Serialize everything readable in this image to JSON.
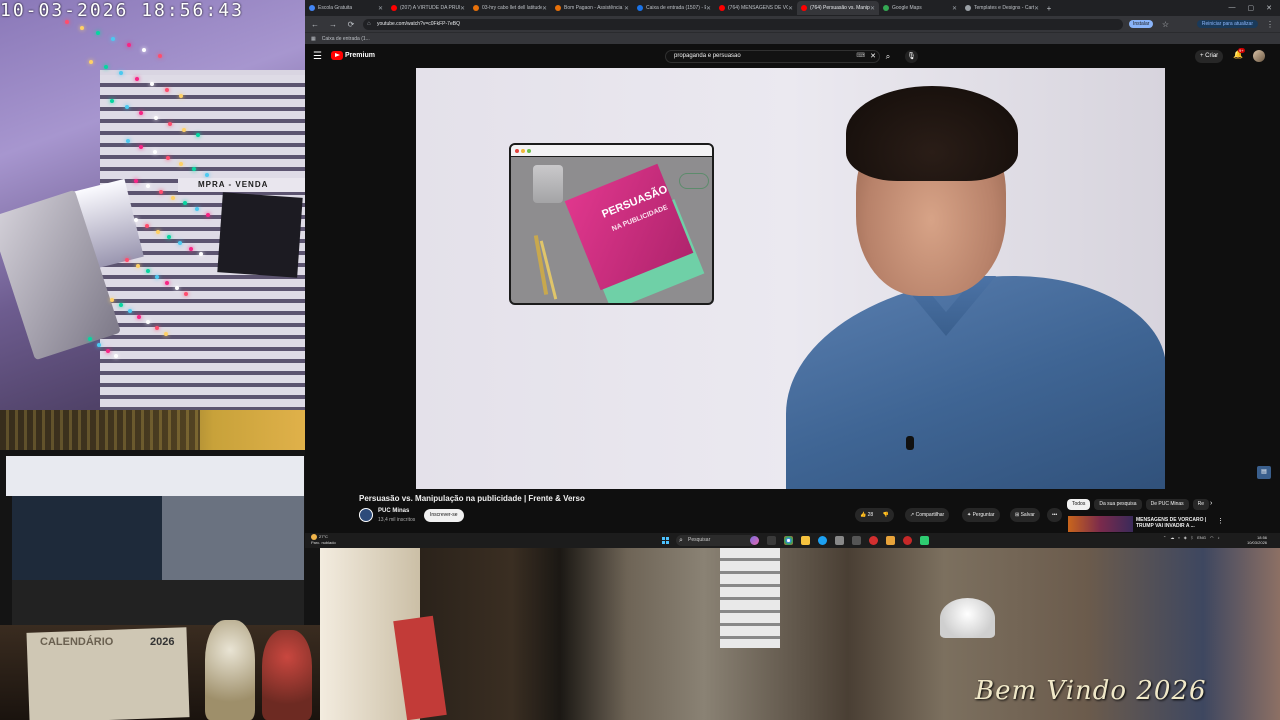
{
  "overlay": {
    "timestamp": "10-03-2026  18:56:43",
    "sign_text": "MPRA - VENDA",
    "calendar_title": "CALENDÁRIO",
    "calendar_year": "2026",
    "welcome": "Bem Vindo 2026"
  },
  "browser": {
    "tabs": [
      {
        "label": "Escola Gratuita",
        "color": "#4285f4"
      },
      {
        "label": "(207) A VIRTUDE DA PRUDÊNCIA",
        "color": "#ff0000"
      },
      {
        "label": "03-hry cabo llet dell latitude 3...",
        "color": "#e8710a"
      },
      {
        "label": "Bom Pagaon - Assistência Técn...",
        "color": "#e8710a"
      },
      {
        "label": "Caixa de entrada (1507) - E-mail",
        "color": "#1a73e8"
      },
      {
        "label": "(764) MENSAGENS DE VORCAR...",
        "color": "#ff0000"
      },
      {
        "label": "(764) Persuasão vs. Manipu...",
        "color": "#ff0000",
        "active": true
      },
      {
        "label": "Google Maps",
        "color": "#34a853"
      },
      {
        "label": "Templates e Designs - Cartão d...",
        "color": "#9aa0a6"
      }
    ],
    "new_tab": "+",
    "controls": [
      "—",
      "▢",
      "✕"
    ],
    "url": "youtube.com/watch?v=c0FkFP-7eBQ",
    "install_label": "Instalar",
    "relaunch_label": "Reiniciar para atualizar",
    "bookmark_label": "Caixa de entrada (1..."
  },
  "youtube": {
    "logo_word": "Premium",
    "search_query": "propaganda e persuasao",
    "create_label": "+ Criar",
    "notification_count": "9+",
    "book_title_line1": "PERSUASÃO",
    "book_title_line2": "NA PUBLICIDADE",
    "video_title": "Persuasão vs. Manipulação na publicidade | Frente & Verso",
    "channel_name": "PUC Minas",
    "channel_subs": "13,4 mil inscritos",
    "subscribe_label": "Inscrever-se",
    "likes": "28",
    "share_label": "Compartilhar",
    "ask_label": "Perguntar",
    "save_label": "Salvar",
    "more_label": "•••",
    "chips": [
      "Todos",
      "Da sua pesquisa",
      "De PUC Minas",
      "Re"
    ],
    "rec_title": "MENSAGENS DE VORCARO | TRUMP VAI INVADIR A ..."
  },
  "taskbar": {
    "weather_temp": "27°C",
    "weather_desc": "Parc. nublado",
    "search_placeholder": "Pesquisar",
    "language": "ENG",
    "time": "18:56",
    "date": "10/03/2026"
  },
  "colors": {
    "youtube_red": "#ff0000",
    "player_bg": "#e6e3ec",
    "book_pink": "#e0378d"
  }
}
